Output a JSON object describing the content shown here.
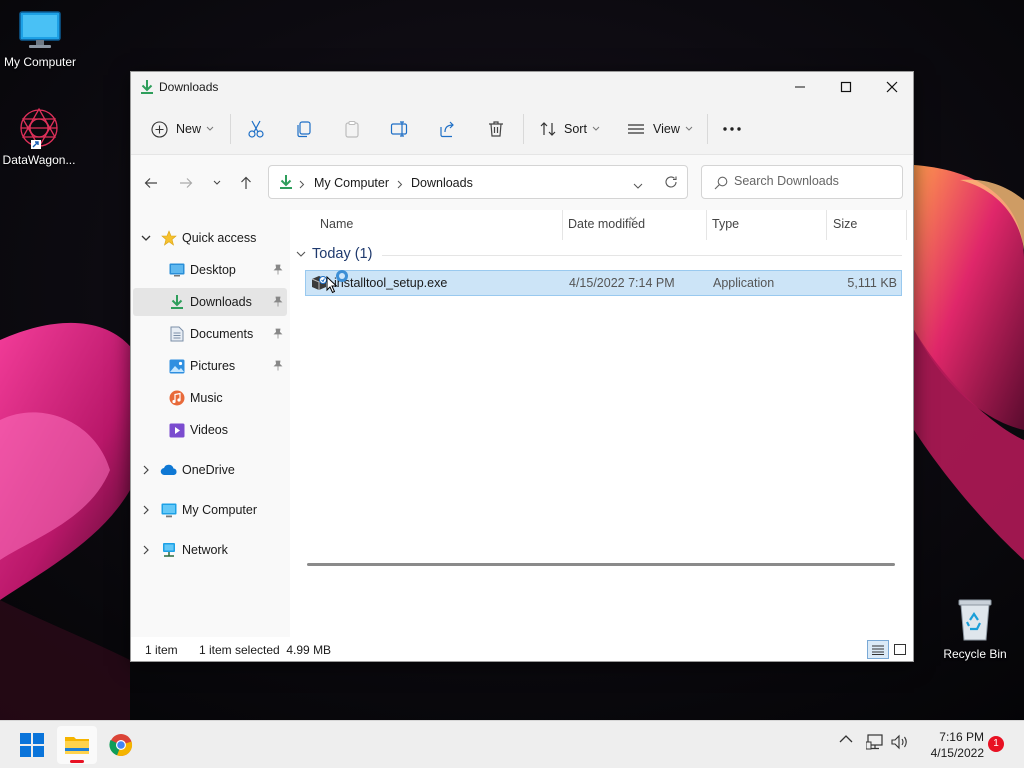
{
  "desktop": {
    "icons": [
      {
        "label": "My Computer",
        "icon": "monitor-icon"
      },
      {
        "label": "DataWagon...",
        "icon": "datawagon-shortcut-icon"
      },
      {
        "label": "Recycle Bin",
        "icon": "recycle-bin-icon"
      }
    ]
  },
  "window": {
    "title": "Downloads",
    "title_icon": "download-arrow-icon",
    "controls": [
      "minimize",
      "maximize",
      "close"
    ]
  },
  "toolbar": {
    "new_label": "New",
    "sort_label": "Sort",
    "view_label": "View",
    "icons": [
      "cut-icon",
      "copy-icon",
      "paste-icon",
      "rename-icon",
      "share-icon",
      "delete-icon",
      "more-icon"
    ]
  },
  "nav": {
    "breadcrumb": [
      "My Computer",
      "Downloads"
    ],
    "search_placeholder": "Search Downloads"
  },
  "sidebar": {
    "quick_access": "Quick access",
    "items": [
      {
        "label": "Desktop",
        "icon": "desktop-folder-icon",
        "pinned": true
      },
      {
        "label": "Downloads",
        "icon": "downloads-folder-icon",
        "pinned": true,
        "selected": true
      },
      {
        "label": "Documents",
        "icon": "documents-folder-icon",
        "pinned": true
      },
      {
        "label": "Pictures",
        "icon": "pictures-folder-icon",
        "pinned": true
      },
      {
        "label": "Music",
        "icon": "music-folder-icon",
        "pinned": false
      },
      {
        "label": "Videos",
        "icon": "videos-folder-icon",
        "pinned": false
      }
    ],
    "roots": [
      {
        "label": "OneDrive",
        "icon": "onedrive-cloud-icon"
      },
      {
        "label": "My Computer",
        "icon": "monitor-icon"
      },
      {
        "label": "Network",
        "icon": "network-icon"
      }
    ]
  },
  "content": {
    "columns": [
      "Name",
      "Date modified",
      "Type",
      "Size"
    ],
    "group_label": "Today (1)",
    "files": [
      {
        "name": "installtool_setup.exe",
        "date": "4/15/2022 7:14 PM",
        "type": "Application",
        "size": "5,111 KB",
        "selected": true
      }
    ]
  },
  "status": {
    "count": "1 item",
    "selection": "1 item selected  4.99 MB"
  },
  "taskbar": {
    "apps": [
      "start-icon",
      "file-explorer-icon",
      "chrome-icon"
    ],
    "time": "7:16 PM",
    "date": "4/15/2022",
    "notification_count": "1"
  },
  "colors": {
    "selection_fill": "#cce4f7",
    "selection_border": "#99c9ef",
    "accent_green": "#2e9e5b",
    "notification_red": "#e81123"
  }
}
